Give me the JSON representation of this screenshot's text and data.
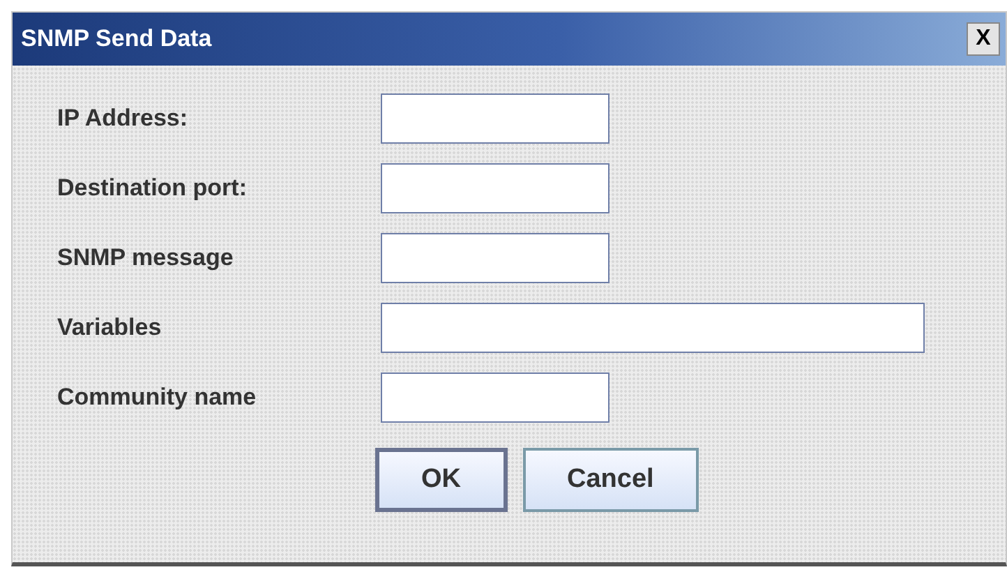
{
  "window": {
    "title": "SNMP Send Data",
    "close": "X"
  },
  "fields": [
    {
      "label": "IP Address:",
      "wide": false
    },
    {
      "label": "Destination port:",
      "wide": false
    },
    {
      "label": "SNMP message",
      "wide": false
    },
    {
      "label": "Variables",
      "wide": true
    },
    {
      "label": "Community name",
      "wide": false
    }
  ],
  "buttons": [
    {
      "label": "OK",
      "default": true
    },
    {
      "label": "Cancel",
      "default": false
    }
  ]
}
